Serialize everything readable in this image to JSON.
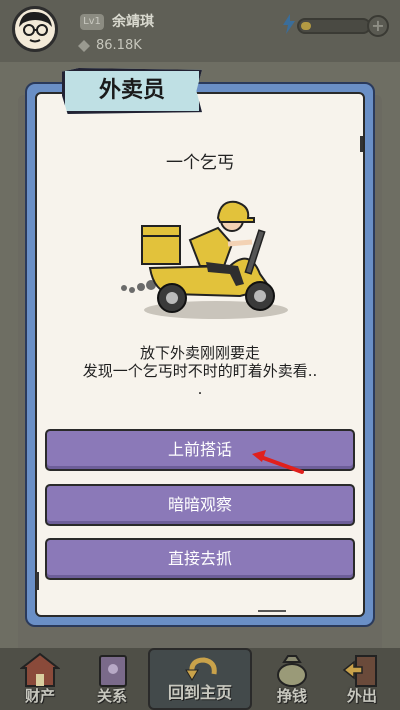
{
  "hud": {
    "level": "Lv1",
    "player_name": "余靖琪",
    "money": "86.18K",
    "energy_fraction": 0.15
  },
  "dialog": {
    "title": "外卖员",
    "event_title": "一个乞丐",
    "story_lines": [
      "放下外卖刚刚要走",
      "发现一个乞丐时不时的盯着外卖看..",
      "."
    ],
    "choices": [
      "上前搭话",
      "暗暗观察",
      "直接去抓"
    ]
  },
  "nav": {
    "items": [
      "财产",
      "关系",
      "回到主页",
      "挣钱",
      "外出"
    ]
  },
  "colors": {
    "dialog_frame": "#6a8fc6",
    "choice_button": "#8b79b8",
    "title_tag": "#bfe0e4",
    "arrow": "#e0201c",
    "scooter": "#e2c23b"
  },
  "icons": [
    "avatar",
    "money-icon",
    "energy-icon",
    "plus-icon",
    "delivery-scooter",
    "red-arrow"
  ]
}
